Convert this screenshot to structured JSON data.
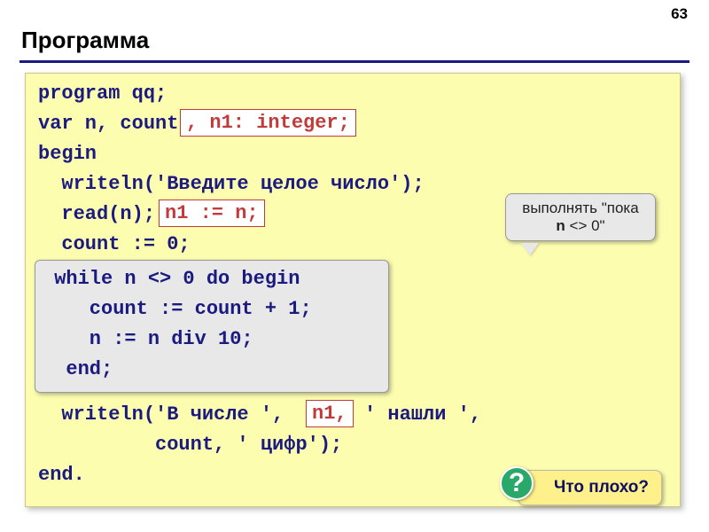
{
  "page_number": "63",
  "title": "Программа",
  "code": {
    "l1": "program qq;",
    "l2": "var n, count",
    "hl1": ", n1: integer;",
    "l3": "begin",
    "l4": "  writeln('Введите целое число');",
    "l5": "  read(n);",
    "hl2": "n1 := n;",
    "l6": "  count := 0;",
    "inner1": " while n <> 0 do begin",
    "inner2": "    count := count + 1;",
    "inner3": "    n := n div 10;",
    "inner4": "  end;",
    "l7a": "  writeln('В числе ',",
    "hl3": "n1,",
    "l7b": "' нашли ',",
    "l8": "          count, ' цифр');",
    "l9": "end."
  },
  "callout": {
    "line1": "выполнять \"пока",
    "line2a": "n ",
    "line2b": "<> 0\""
  },
  "badge": {
    "text": "Что плохо?",
    "mark": "?"
  }
}
